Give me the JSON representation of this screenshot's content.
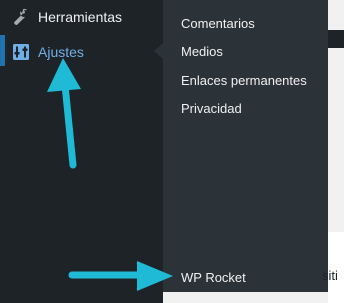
{
  "sidebar": {
    "items": [
      {
        "label": "Herramientas",
        "icon": "wrench-icon"
      },
      {
        "label": "Ajustes",
        "icon": "settings-sliders-icon",
        "active": true
      }
    ]
  },
  "submenu": {
    "items": [
      {
        "label": "Comentarios"
      },
      {
        "label": "Medios"
      },
      {
        "label": "Enlaces permanentes"
      },
      {
        "label": "Privacidad"
      },
      {
        "label": "WP Rocket"
      }
    ]
  },
  "content": {
    "partial_text": "siti"
  },
  "colors": {
    "sidebar_bg": "#1d2327",
    "submenu_bg": "#2c3338",
    "active_link": "#72aee6",
    "active_bar": "#2271b1",
    "annotation_arrow": "#1fbad6"
  }
}
